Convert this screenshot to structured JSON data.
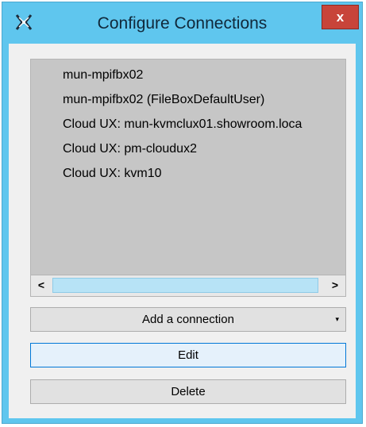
{
  "window": {
    "title": "Configure Connections",
    "close_label": "x",
    "accent_color": "#5fc6ee",
    "close_color": "#c8443a"
  },
  "connections": [
    "mun-mpifbx02",
    "mun-mpifbx02 (FileBoxDefaultUser)",
    "Cloud UX: mun-kvmclux01.showroom.loca",
    "Cloud UX: pm-cloudux2",
    "Cloud UX: kvm10"
  ],
  "scrollbar": {
    "left_arrow": "<",
    "right_arrow": ">"
  },
  "buttons": {
    "add_label": "Add a connection",
    "add_dropdown_icon": "▾",
    "edit_label": "Edit",
    "delete_label": "Delete"
  }
}
